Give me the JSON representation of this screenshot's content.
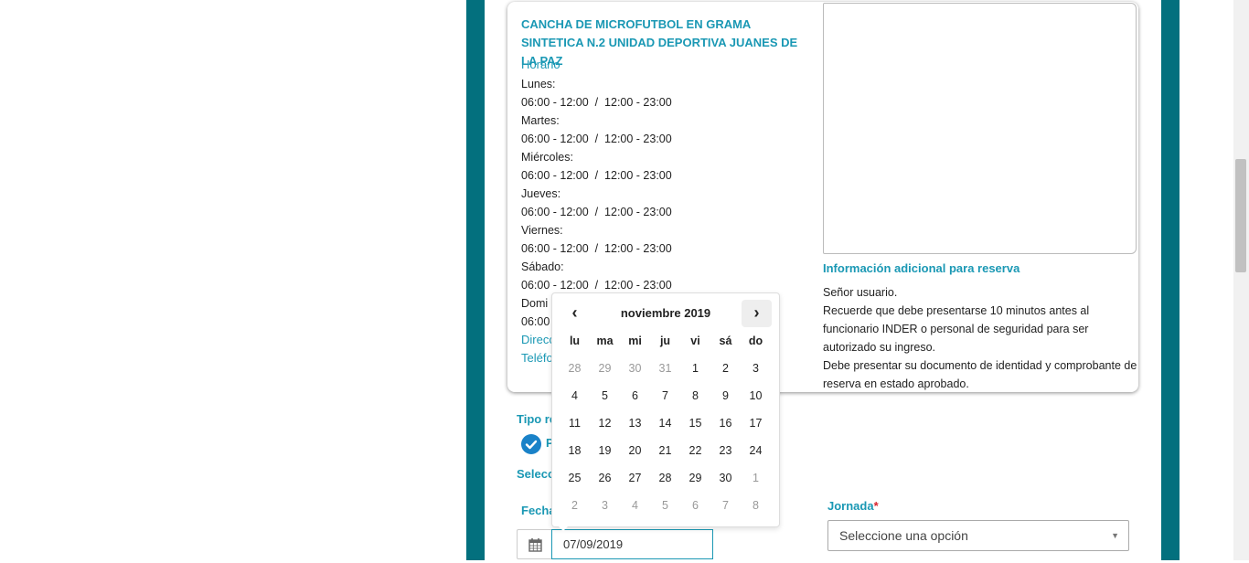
{
  "facility": {
    "title": "CANCHA DE MICROFUTBOL EN GRAMA SINTETICA N.2 UNIDAD DEPORTIVA JUANES DE LA PAZ",
    "schedule_label": "Horario",
    "schedule": [
      {
        "day": "Lunes:",
        "hours": "06:00 - 12:00  /  12:00 - 23:00"
      },
      {
        "day": "Martes:",
        "hours": "06:00 - 12:00  /  12:00 - 23:00"
      },
      {
        "day": "Miércoles:",
        "hours": "06:00 - 12:00  /  12:00 - 23:00"
      },
      {
        "day": "Jueves:",
        "hours": "06:00 - 12:00  /  12:00 - 23:00"
      },
      {
        "day": "Viernes:",
        "hours": "06:00 - 12:00  /  12:00 - 23:00"
      },
      {
        "day": "Sábado:",
        "hours": "06:00 - 12:00  /  12:00 - 23:00"
      },
      {
        "day": "Domi",
        "hours": "06:00"
      }
    ],
    "direction_label": "Direcc",
    "phone_label": "Teléfo"
  },
  "info": {
    "title": "Información adicional para reserva",
    "lines": [
      "Señor usuario.",
      "Recuerde que debe presentarse 10 minutos antes al funcionario INDER o personal de seguridad para ser autorizado su ingreso.",
      "Debe presentar su documento de identidad y comprobante de reserva en estado aprobado."
    ]
  },
  "form": {
    "tipo_label": "Tipo re",
    "tipo_option_letter": "P",
    "select_label": "Selecc",
    "fecha_label": "Fecha",
    "date_value": "07/09/2019",
    "jornada_label": "Jornada",
    "jornada_required": "*",
    "jornada_value": "Seleccione una opción"
  },
  "datepicker": {
    "prev": "‹",
    "next": "›",
    "month": "noviembre 2019",
    "weekdays": [
      "lu",
      "ma",
      "mi",
      "ju",
      "vi",
      "sá",
      "do"
    ],
    "weeks": [
      [
        {
          "d": "28",
          "m": true
        },
        {
          "d": "29",
          "m": true
        },
        {
          "d": "30",
          "m": true
        },
        {
          "d": "31",
          "m": true
        },
        {
          "d": "1"
        },
        {
          "d": "2"
        },
        {
          "d": "3"
        }
      ],
      [
        {
          "d": "4"
        },
        {
          "d": "5"
        },
        {
          "d": "6"
        },
        {
          "d": "7"
        },
        {
          "d": "8"
        },
        {
          "d": "9"
        },
        {
          "d": "10"
        }
      ],
      [
        {
          "d": "11"
        },
        {
          "d": "12"
        },
        {
          "d": "13"
        },
        {
          "d": "14"
        },
        {
          "d": "15"
        },
        {
          "d": "16"
        },
        {
          "d": "17"
        }
      ],
      [
        {
          "d": "18"
        },
        {
          "d": "19"
        },
        {
          "d": "20"
        },
        {
          "d": "21"
        },
        {
          "d": "22"
        },
        {
          "d": "23"
        },
        {
          "d": "24"
        }
      ],
      [
        {
          "d": "25"
        },
        {
          "d": "26"
        },
        {
          "d": "27"
        },
        {
          "d": "28"
        },
        {
          "d": "29"
        },
        {
          "d": "30"
        },
        {
          "d": "1",
          "m": true
        }
      ],
      [
        {
          "d": "2",
          "m": true
        },
        {
          "d": "3",
          "m": true
        },
        {
          "d": "4",
          "m": true
        },
        {
          "d": "5",
          "m": true
        },
        {
          "d": "6",
          "m": true
        },
        {
          "d": "7",
          "m": true
        },
        {
          "d": "8",
          "m": true
        }
      ]
    ]
  },
  "icons": {
    "calendar": "calendar-icon",
    "check": "check-circle-icon",
    "dropdown": "dropdown-arrow-icon"
  },
  "colors": {
    "frame": "#03707e",
    "accent": "#1a98b4",
    "check": "#1a82c8",
    "required": "#d9232d"
  }
}
